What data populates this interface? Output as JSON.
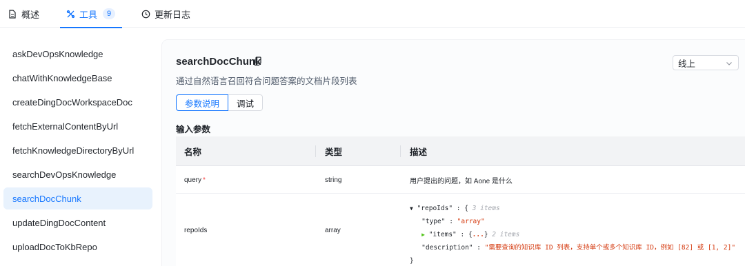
{
  "tabs": [
    {
      "label": "概述",
      "icon": "document-icon"
    },
    {
      "label": "工具",
      "icon": "tools-icon",
      "badge": "9"
    },
    {
      "label": "更新日志",
      "icon": "clock-icon"
    }
  ],
  "sidebar": {
    "items": [
      {
        "label": "askDevOpsKnowledge"
      },
      {
        "label": "chatWithKnowledgeBase"
      },
      {
        "label": "createDingDocWorkspaceDoc"
      },
      {
        "label": "fetchExternalContentByUrl"
      },
      {
        "label": "fetchKnowledgeDirectoryByUrl"
      },
      {
        "label": "searchDevOpsKnowledge"
      },
      {
        "label": "searchDocChunk",
        "active": true
      },
      {
        "label": "updateDingDocContent"
      },
      {
        "label": "uploadDocToKbRepo"
      }
    ]
  },
  "tool": {
    "title": "searchDocChunk",
    "description": "通过自然语言召回符合问题答案的文档片段列表",
    "environment": "线上",
    "seg_params": "参数说明",
    "seg_debug": "调试",
    "section_title": "输入参数"
  },
  "table": {
    "headers": [
      "名称",
      "类型",
      "描述"
    ],
    "rows": [
      {
        "name": "query",
        "required": "*",
        "type": "string",
        "desc": "用户提出的问题，如 Aone 是什么"
      },
      {
        "name": "repoIds",
        "type": "array"
      }
    ]
  },
  "json_desc": {
    "key_root": "\"repoIds\"",
    "root_meta": "3 items",
    "key_type": "\"type\"",
    "val_type": "\"array\"",
    "key_items": "\"items\"",
    "items_meta": "2 items",
    "key_description": "\"description\"",
    "val_description": "\"需要查询的知识库 ID 列表，支持单个或多个知识库 ID，例如 [82] 或 [1, 2]\""
  },
  "colors": {
    "accent": "#1677ff",
    "required": "#f53f3f"
  }
}
